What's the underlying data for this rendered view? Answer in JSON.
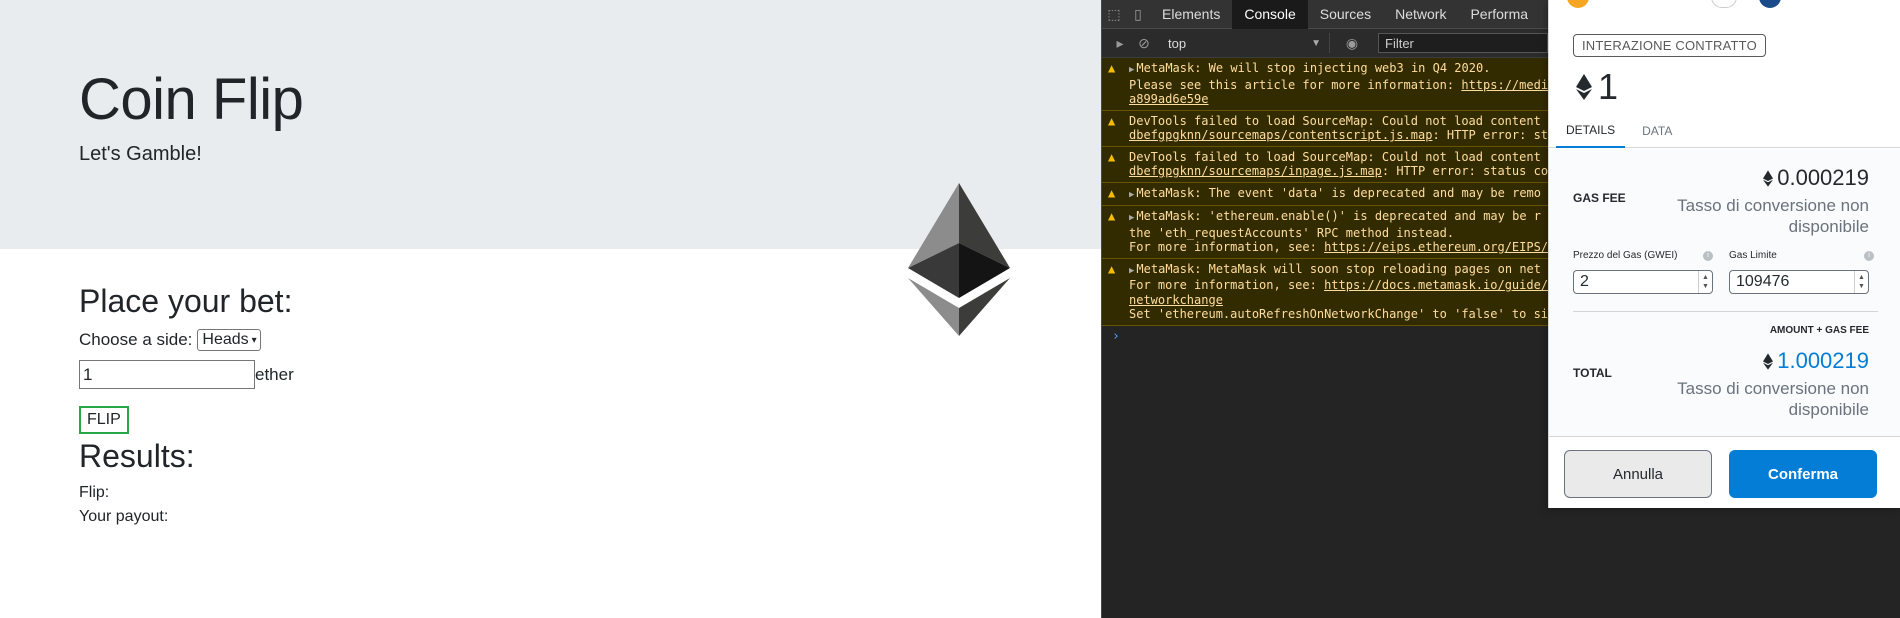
{
  "page": {
    "title": "Coin Flip",
    "subtitle": "Let's Gamble!",
    "bet_heading": "Place your bet:",
    "choose_label": "Choose a side:",
    "side_selected": "Heads",
    "amount_value": "1",
    "amount_unit": "ether",
    "flip_button": "FLIP",
    "results_heading": "Results:",
    "flip_label": "Flip:",
    "payout_label": "Your payout:"
  },
  "devtools": {
    "tabs": [
      "Elements",
      "Console",
      "Sources",
      "Network",
      "Performa"
    ],
    "active_tab": "Console",
    "context": "top",
    "filter_placeholder": "Filter",
    "messages": [
      {
        "lines": [
          "MetaMask: We will stop injecting web3 in Q4 2020.",
          "Please see this article for more information: ",
          "a899ad6e59e"
        ],
        "link": "https://medi"
      },
      {
        "lines": [
          "DevTools failed to load SourceMap: Could not load content",
          "dbefgpgknn/sourcemaps/contentscript.js.map",
          ": HTTP error: st"
        ]
      },
      {
        "lines": [
          "DevTools failed to load SourceMap: Could not load content",
          "dbefgpgknn/sourcemaps/inpage.js.map",
          ": HTTP error: status co"
        ]
      },
      {
        "lines": [
          "MetaMask: The event 'data' is deprecated and may be remo"
        ]
      },
      {
        "lines": [
          "MetaMask: 'ethereum.enable()' is deprecated and may be r",
          "the 'eth_requestAccounts' RPC method instead.",
          "For more information, see: ",
          "https://eips.ethereum.org/EIPS/"
        ]
      },
      {
        "lines": [
          "MetaMask: MetaMask will soon stop reloading pages on net",
          "For more information, see: ",
          "https://docs.metamask.io/guide/",
          "networkchange",
          "Set 'ethereum.autoRefreshOnNetworkChange' to 'false' to si"
        ]
      }
    ]
  },
  "metamask": {
    "badge": "INTERAZIONE CONTRATTO",
    "amount": "1",
    "tabs": [
      "DETAILS",
      "DATA"
    ],
    "gas_fee_label": "GAS FEE",
    "gas_fee_value": "0.000219",
    "conversion_unavailable": "Tasso di conversione non disponibile",
    "gas_price_label": "Prezzo del Gas (GWEI)",
    "gas_price_value": "2",
    "gas_limit_label": "Gas Limite",
    "gas_limit_value": "109476",
    "amount_gas_label": "AMOUNT + GAS FEE",
    "total_label": "TOTAL",
    "total_value": "1.000219",
    "cancel_button": "Annulla",
    "confirm_button": "Conferma",
    "accent_color": "#037dd6"
  }
}
